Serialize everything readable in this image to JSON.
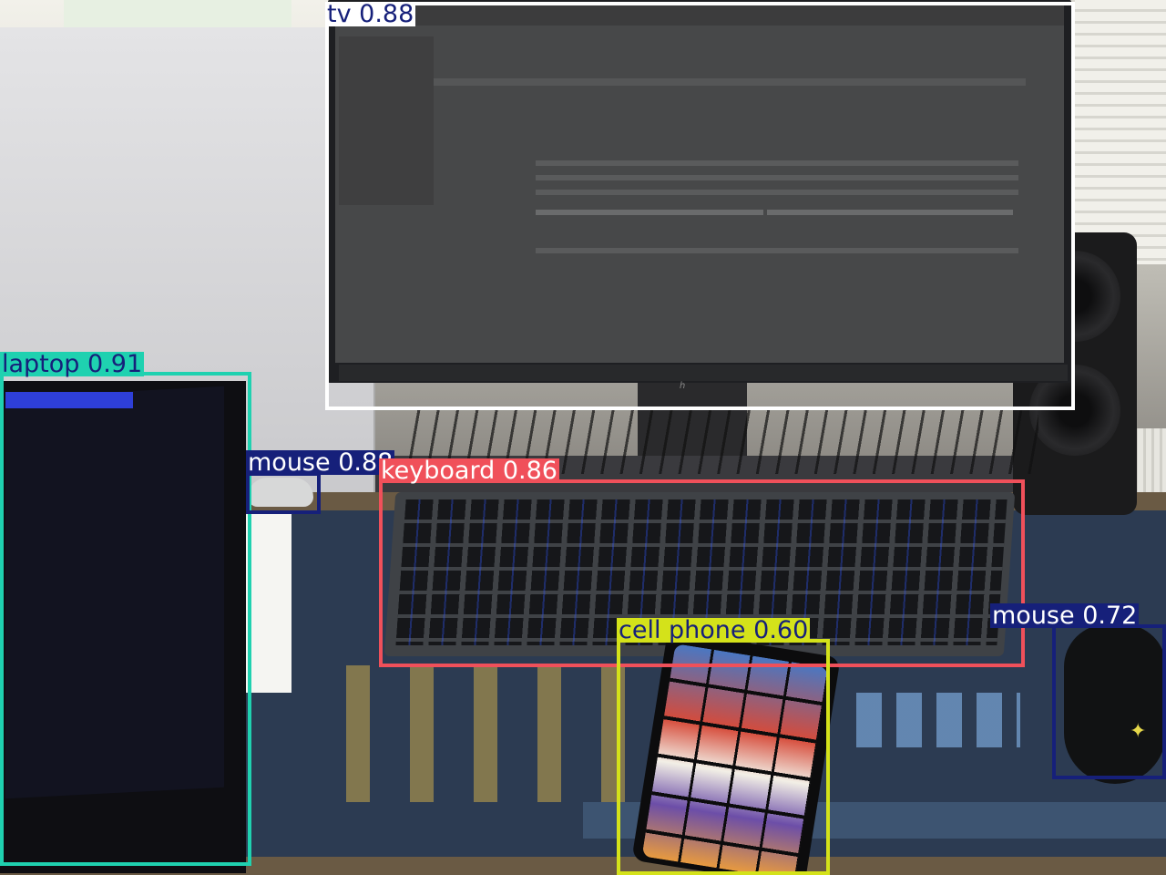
{
  "detections": [
    {
      "id": "tv",
      "label": "tv",
      "score": "0.88",
      "color": "#ffffff",
      "text_color": "#16207a"
    },
    {
      "id": "laptop",
      "label": "laptop",
      "score": "0.91",
      "color": "#1fd1b0",
      "text_color": "#16207a"
    },
    {
      "id": "mouse-left",
      "label": "mouse",
      "score": "0.88",
      "color": "#16207a",
      "text_color": "#ffffff"
    },
    {
      "id": "keyboard",
      "label": "keyboard",
      "score": "0.86",
      "color": "#f0505a",
      "text_color": "#ffffff"
    },
    {
      "id": "cell-phone",
      "label": "cell phone",
      "score": "0.60",
      "color": "#d4e21a",
      "text_color": "#16207a"
    },
    {
      "id": "mouse-right",
      "label": "mouse",
      "score": "0.72",
      "color": "#16207a",
      "text_color": "#ffffff"
    }
  ]
}
